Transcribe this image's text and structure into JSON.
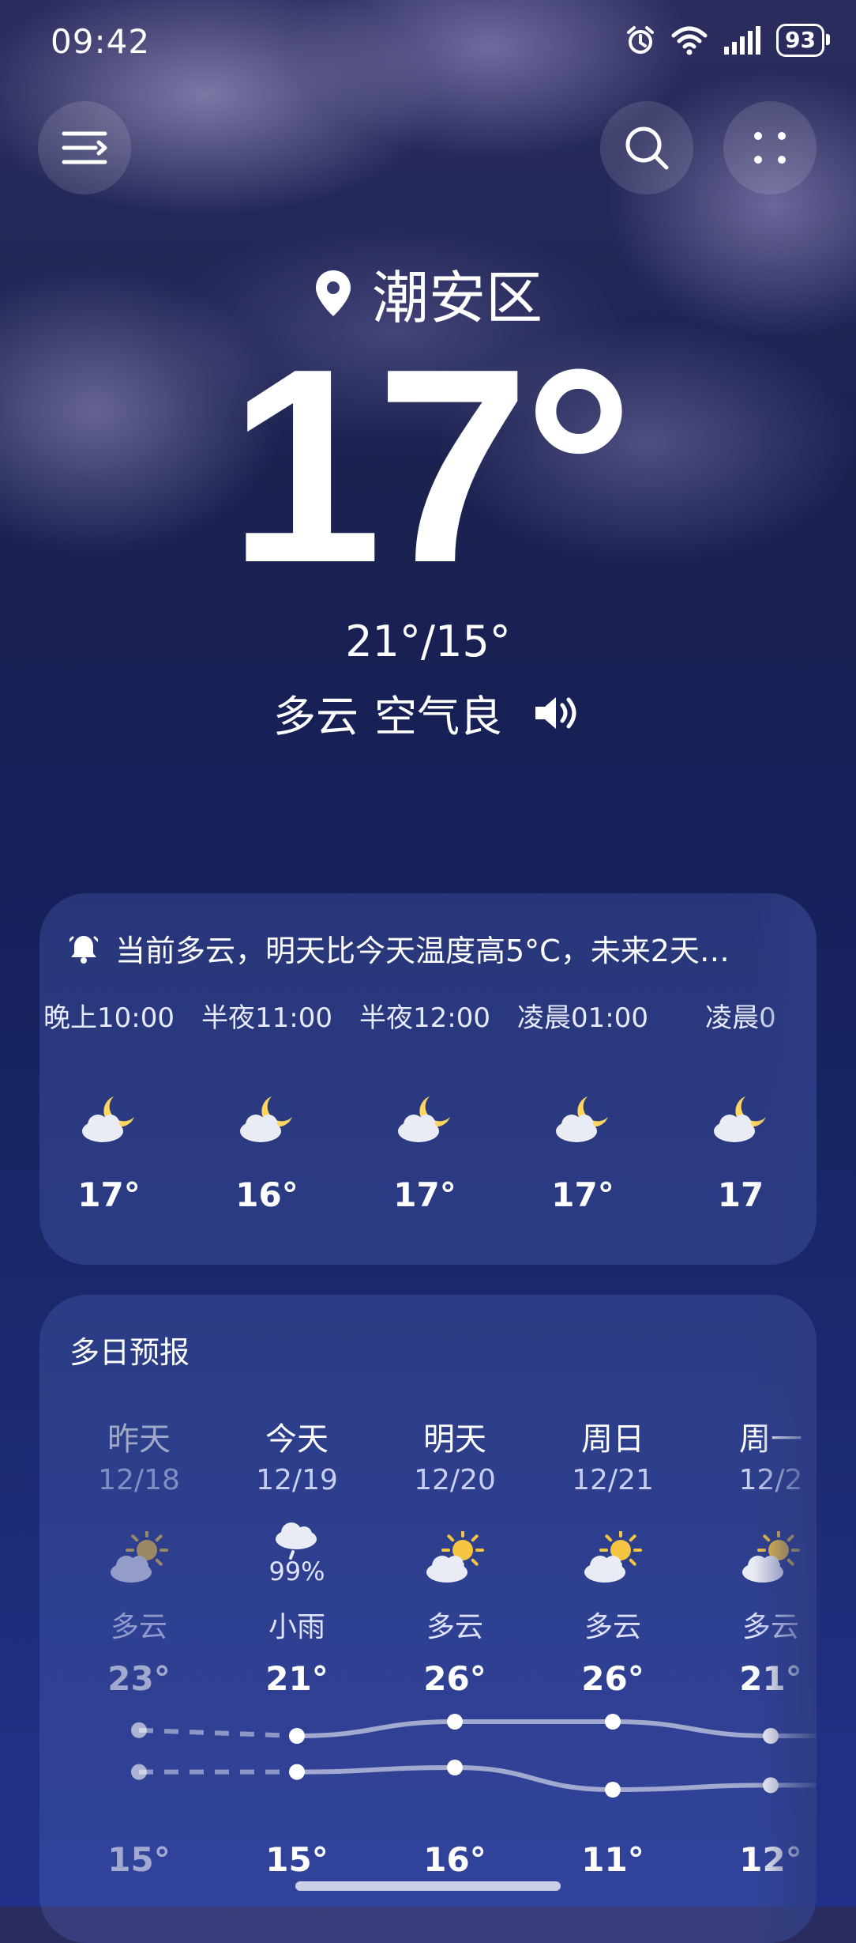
{
  "status_bar": {
    "time": "09:42",
    "battery": "93"
  },
  "header": {
    "location": "潮安区",
    "current_temp": "17°",
    "high_low": "21°/15°",
    "condition": "多云",
    "air_quality": "空气良"
  },
  "hourly": {
    "alert": "当前多云，明天比今天温度高5°C，未来2天…",
    "items": [
      {
        "time": "晚上10:00",
        "temp": "17°",
        "icon": "moon-cloud-icon"
      },
      {
        "time": "半夜11:00",
        "temp": "16°",
        "icon": "moon-cloud-icon"
      },
      {
        "time": "半夜12:00",
        "temp": "17°",
        "icon": "moon-cloud-icon"
      },
      {
        "time": "凌晨01:00",
        "temp": "17°",
        "icon": "moon-cloud-icon"
      },
      {
        "time": "凌晨0",
        "temp": "17",
        "icon": "moon-cloud-icon"
      }
    ]
  },
  "daily": {
    "title": "多日预报",
    "items": [
      {
        "day": "昨天",
        "date": "12/18",
        "cond": "多云",
        "high": "23°",
        "low": "15°",
        "high_value": 23,
        "low_value": 15,
        "icon": "sun-cloud-icon"
      },
      {
        "day": "今天",
        "date": "12/19",
        "cond": "小雨",
        "precip": "99%",
        "high": "21°",
        "low": "15°",
        "high_value": 21,
        "low_value": 15,
        "icon": "rain-cloud-icon"
      },
      {
        "day": "明天",
        "date": "12/20",
        "cond": "多云",
        "high": "26°",
        "low": "16°",
        "high_value": 26,
        "low_value": 16,
        "icon": "sun-cloud-icon"
      },
      {
        "day": "周日",
        "date": "12/21",
        "cond": "多云",
        "high": "26°",
        "low": "11°",
        "high_value": 26,
        "low_value": 11,
        "icon": "sun-cloud-icon"
      },
      {
        "day": "周一",
        "date": "12/2",
        "cond": "多云",
        "high": "21°",
        "low": "12°",
        "high_value": 21,
        "low_value": 12,
        "icon": "sun-cloud-icon"
      }
    ]
  },
  "colors": {
    "sun": "#f5c542",
    "cloud": "#e9ebf5",
    "moon": "#ffd75e"
  }
}
